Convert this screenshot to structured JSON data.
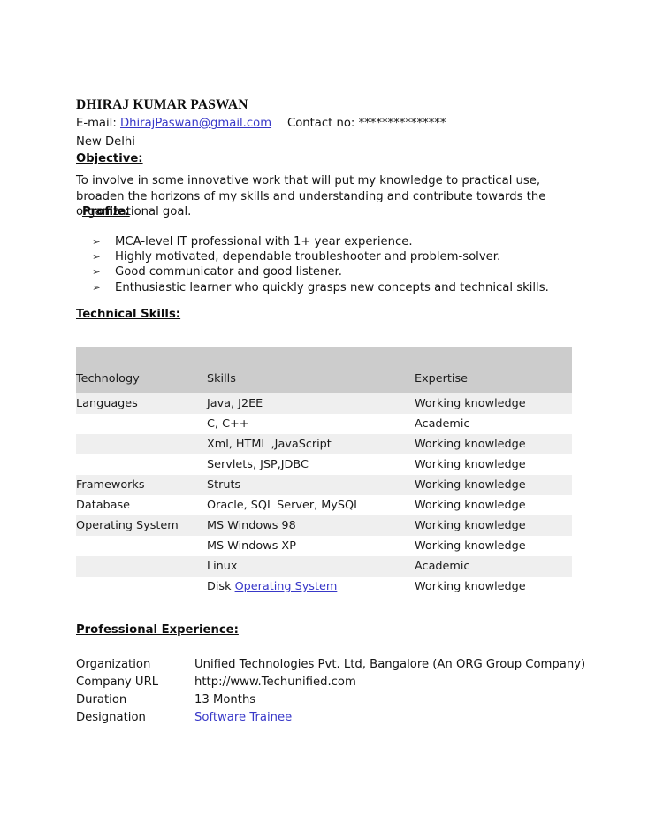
{
  "document": {
    "name": "DHIRAJ KUMAR PASWAN",
    "email_label": "E-mail: ",
    "email": "DhirajPaswan@gmail.com",
    "contact_label": "Contact no: ",
    "contact_value": "***************",
    "city": "New Delhi"
  },
  "objective": {
    "heading": "Objective:",
    "text": "To involve in some innovative work that will put my knowledge to practical use, broaden the horizons of my skills and understanding and contribute towards the organizational goal."
  },
  "profile": {
    "heading": "Profile:",
    "bullet_glyph": "➢",
    "items": [
      "MCA-level IT professional with 1+ year experience.",
      "Highly motivated, dependable troubleshooter and problem-solver.",
      "Good communicator and good listener.",
      "Enthusiastic learner who quickly grasps new concepts and technical skills."
    ]
  },
  "technical_skills": {
    "heading": "Technical Skills:",
    "columns": [
      "Technology",
      "Skills",
      "Expertise"
    ],
    "rows": [
      {
        "technology": "Languages",
        "skills": "Java, J2EE",
        "skills_link": "",
        "expertise": "Working knowledge"
      },
      {
        "technology": "",
        "skills": "C, C++",
        "skills_link": "",
        "expertise": "Academic"
      },
      {
        "technology": "",
        "skills": "Xml, HTML ,JavaScript",
        "skills_link": "",
        "expertise": "Working knowledge"
      },
      {
        "technology": "",
        "skills": "Servlets, JSP,JDBC",
        "skills_link": "",
        "expertise": "Working knowledge"
      },
      {
        "technology": "Frameworks",
        "skills": "Struts",
        "skills_link": "",
        "expertise": "Working knowledge"
      },
      {
        "technology": "Database",
        "skills": "Oracle, SQL Server, MySQL",
        "skills_link": "",
        "expertise": "Working knowledge"
      },
      {
        "technology": "Operating System",
        "skills": "MS Windows 98",
        "skills_link": "",
        "expertise": "Working knowledge"
      },
      {
        "technology": "",
        "skills": "MS Windows XP",
        "skills_link": "",
        "expertise": "Working knowledge"
      },
      {
        "technology": "",
        "skills": "Linux",
        "skills_link": "",
        "expertise": "Academic"
      },
      {
        "technology": "",
        "skills": "Disk ",
        "skills_link": "Operating System",
        "expertise": "Working knowledge"
      }
    ]
  },
  "professional_experience": {
    "heading": "Professional Experience:",
    "rows": [
      {
        "key": "Organization",
        "value": "Unified Technologies Pvt. Ltd, Bangalore (An ORG Group Company)",
        "is_link": false
      },
      {
        "key": "Company URL",
        "value": "http://www.Techunified.com",
        "is_link": false
      },
      {
        "key": "Duration",
        "value": "13 Months",
        "is_link": false
      },
      {
        "key": "Designation",
        "value": "Software Trainee",
        "is_link": true
      }
    ]
  },
  "colors": {
    "link": "#3838c8",
    "table_header_bg": "#cccccc",
    "table_row_shade": "#efefef",
    "page_bg": "#ffffff",
    "text": "#141414"
  }
}
